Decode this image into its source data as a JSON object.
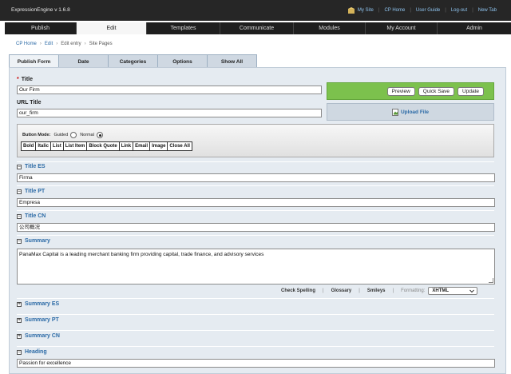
{
  "app": {
    "name": "ExpressionEngine  v 1.6.8"
  },
  "top_links": [
    "My Site",
    "CP Home",
    "User Guide",
    "Log-out",
    "New Tab"
  ],
  "nav": [
    "Publish",
    "Edit",
    "Templates",
    "Communicate",
    "Modules",
    "My Account",
    "Admin"
  ],
  "breadcrumb": {
    "items": [
      "CP Home",
      "Edit",
      "Edit entry",
      "Site Pages"
    ],
    "sep": "›"
  },
  "tabs": [
    "Publish Form",
    "Date",
    "Categories",
    "Options",
    "Show All"
  ],
  "title_field": {
    "required_mark": "*",
    "label": "Title",
    "value": "Our Firm"
  },
  "url_title_field": {
    "label": "URL Title",
    "value": "our_firm"
  },
  "actions": {
    "preview": "Preview",
    "quick_save": "Quick Save",
    "update": "Update",
    "upload": "Upload File"
  },
  "formatting": {
    "mode_label": "Button Mode:",
    "guided": "Guided",
    "normal": "Normal",
    "buttons": [
      "Bold",
      "Italic",
      "List",
      "List Item",
      "Block Quote",
      "Link",
      "Email",
      "Image",
      "Close All"
    ]
  },
  "collapse_open": "−",
  "collapse_closed": "+",
  "fields": {
    "title_es": {
      "label": "Title ES",
      "value": "Firma"
    },
    "title_pt": {
      "label": "Title PT",
      "value": "Empresa"
    },
    "title_cn": {
      "label": "Title CN",
      "value": "公司概况"
    },
    "summary": {
      "label": "Summary",
      "value": "PanaMax Capital is a leading merchant banking firm providing capital, trade finance, and advisory services"
    },
    "summary_es": {
      "label": "Summary ES"
    },
    "summary_pt": {
      "label": "Summary PT"
    },
    "summary_cn": {
      "label": "Summary CN"
    },
    "heading": {
      "label": "Heading",
      "value": "Passion for excellence"
    }
  },
  "tools": {
    "spell": "Check Spelling",
    "glossary": "Glossary",
    "smileys": "Smileys",
    "formatting_label": "Formatting:",
    "formatting_value": "XHTML"
  },
  "colors": {
    "topbar": "#262626",
    "link": "#2b6aa6",
    "green": "#7cc14d",
    "panel": "#e5ebf1"
  }
}
